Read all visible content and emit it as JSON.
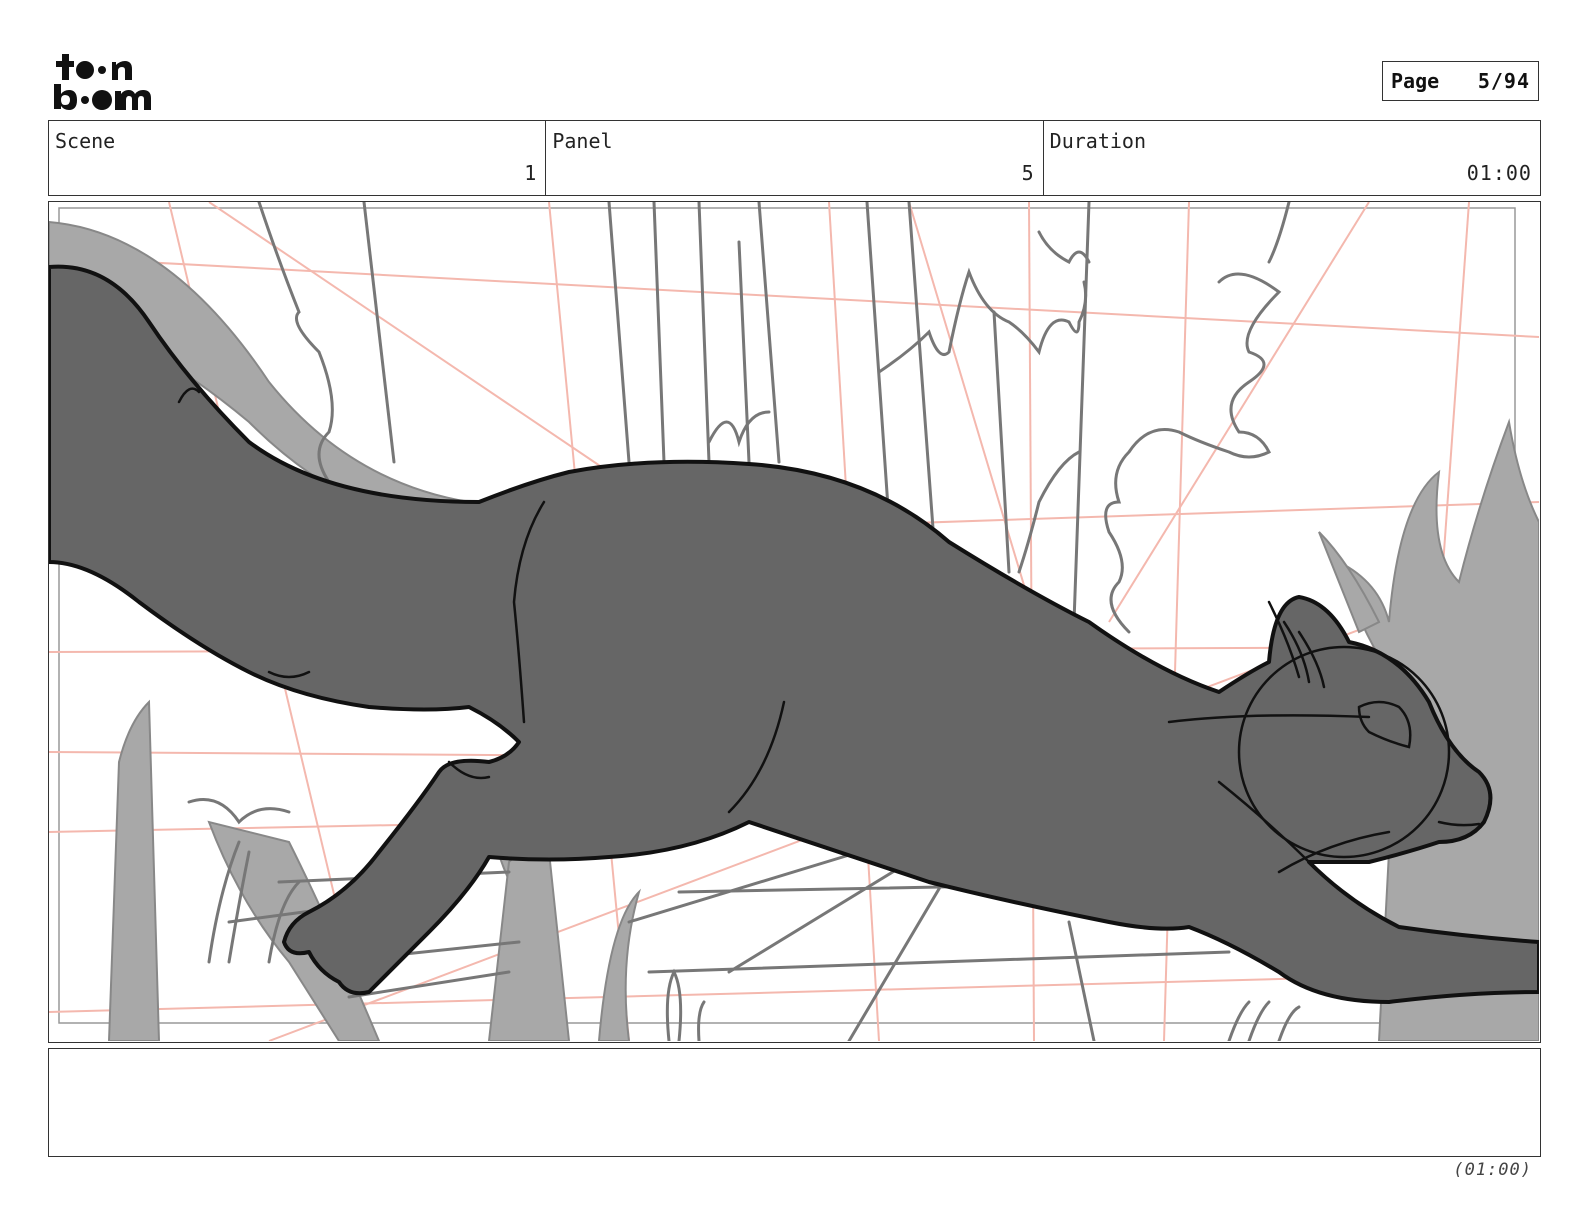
{
  "logo": {
    "line1": "toon",
    "line2": "boom"
  },
  "page": {
    "label": "Page",
    "value": "5/94"
  },
  "info": {
    "scene_label": "Scene",
    "scene_value": "1",
    "panel_label": "Panel",
    "panel_value": "5",
    "duration_label": "Duration",
    "duration_value": "01:00"
  },
  "panel_image": {
    "description_icon": "squirrel-leaping-sketch"
  },
  "notes": {
    "text": ""
  },
  "footer": {
    "duration": "(01:00)"
  },
  "colors": {
    "ink": "#111111",
    "fill_dark": "#666666",
    "fill_light": "#a8a8a8",
    "guide_red": "#f4b8ae",
    "pencil": "#777777"
  }
}
